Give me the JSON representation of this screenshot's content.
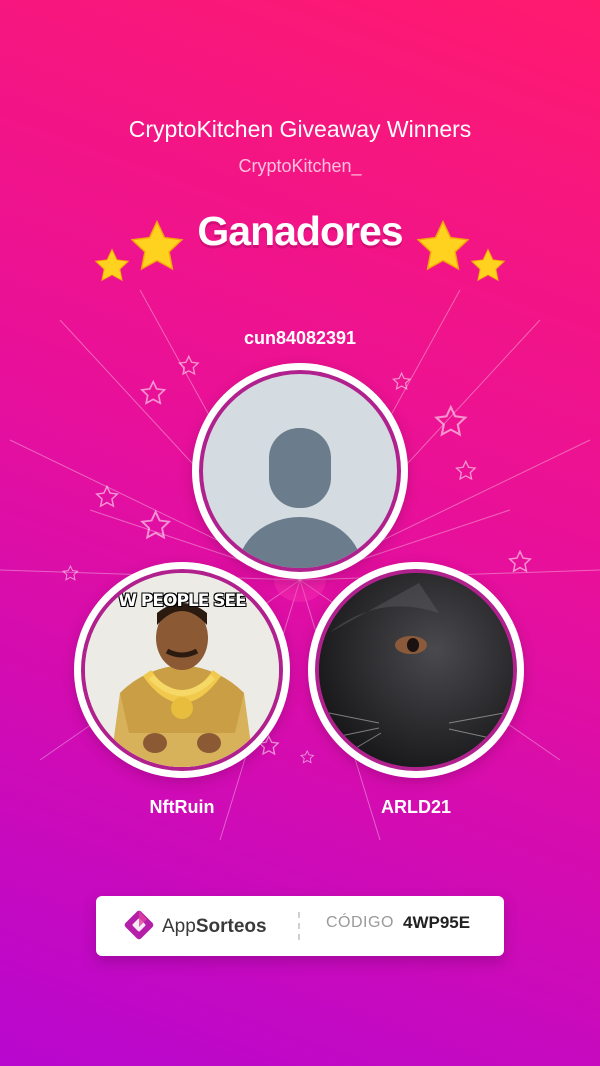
{
  "header": {
    "title": "CryptoKitchen Giveaway Winners",
    "handle": "CryptoKitchen_",
    "heading": "Ganadores"
  },
  "winners": [
    {
      "name": "cun84082391",
      "avatar": "default-profile-icon"
    },
    {
      "name": "NftRuin",
      "avatar": "meme-photo",
      "meme_text": "W PEOPLE SEE"
    },
    {
      "name": "ARLD21",
      "avatar": "black-cat-photo"
    }
  ],
  "footer": {
    "brand_prefix": "App",
    "brand_suffix": "Sorteos",
    "code_label": "CÓDIGO",
    "code_value": "4WP95E"
  },
  "colors": {
    "gradient_top": "#ff1a6e",
    "gradient_bottom": "#b807cf",
    "ring": "#b1218e",
    "star": "#ffd21f",
    "logo": "#b41ea8"
  }
}
